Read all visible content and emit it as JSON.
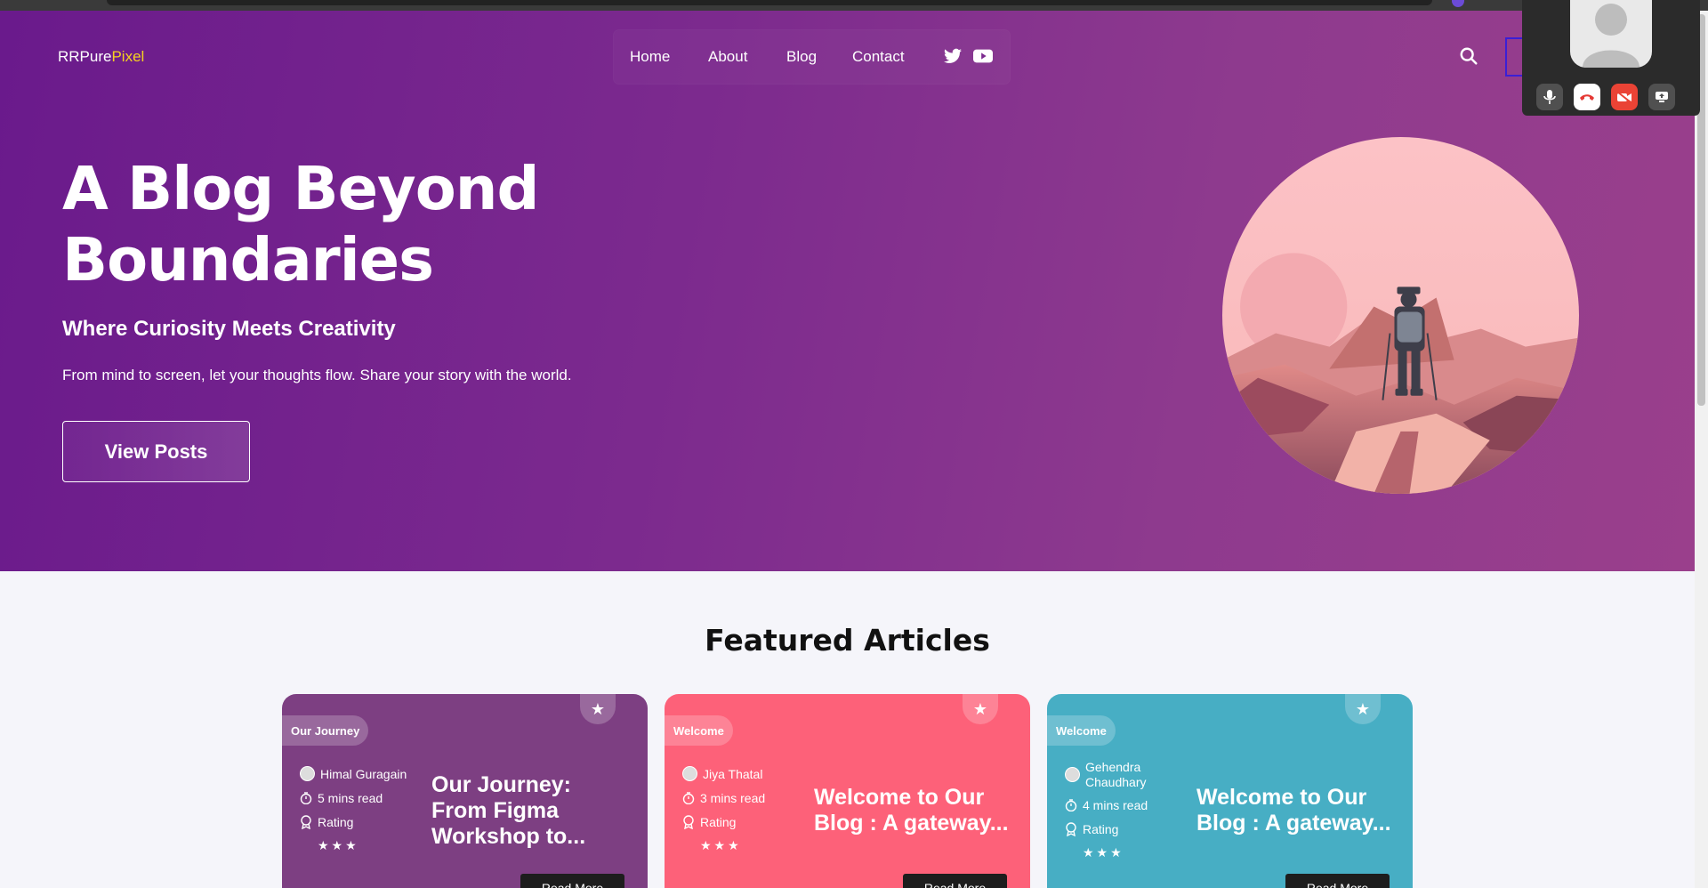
{
  "header": {
    "logo_main": "RRPure",
    "logo_accent": "Pixel",
    "nav": [
      "Home",
      "About",
      "Blog",
      "Contact"
    ],
    "social_icons": [
      "twitter-icon",
      "youtube-icon"
    ]
  },
  "hero": {
    "title": "A Blog Beyond Boundaries",
    "subtitle": "Where Curiosity Meets Creativity",
    "description": "From mind to screen, let your thoughts flow. Share your story with the world.",
    "cta": "View Posts"
  },
  "featured": {
    "title": "Featured Articles",
    "cards": [
      {
        "tag": "Our Journey",
        "author": "Himal Guragain",
        "read_time": "5 mins read",
        "rating_label": "Rating",
        "stars": "★★★",
        "title": "Our Journey: From Figma Workshop to...",
        "read_more": "Read More",
        "color": "#7d3f82"
      },
      {
        "tag": "Welcome",
        "author": "Jiya Thatal",
        "read_time": "3 mins read",
        "rating_label": "Rating",
        "stars": "★★★",
        "title": "Welcome to Our Blog : A gateway...",
        "read_more": "Read More",
        "color": "#fd6179"
      },
      {
        "tag": "Welcome",
        "author": "Gehendra Chaudhary",
        "read_time": "4 mins read",
        "rating_label": "Rating",
        "stars": "★★★",
        "title": "Welcome to Our Blog : A gateway...",
        "read_more": "Read More",
        "color": "#47aec4"
      }
    ]
  },
  "call_widget": {
    "buttons": [
      "mic-icon",
      "hangup-icon",
      "camera-off-icon",
      "screen-share-icon"
    ]
  },
  "colors": {
    "hero_gradient_start": "#6a1a8c",
    "hero_gradient_end": "#9a3f8c",
    "logo_accent": "#f5d120"
  }
}
